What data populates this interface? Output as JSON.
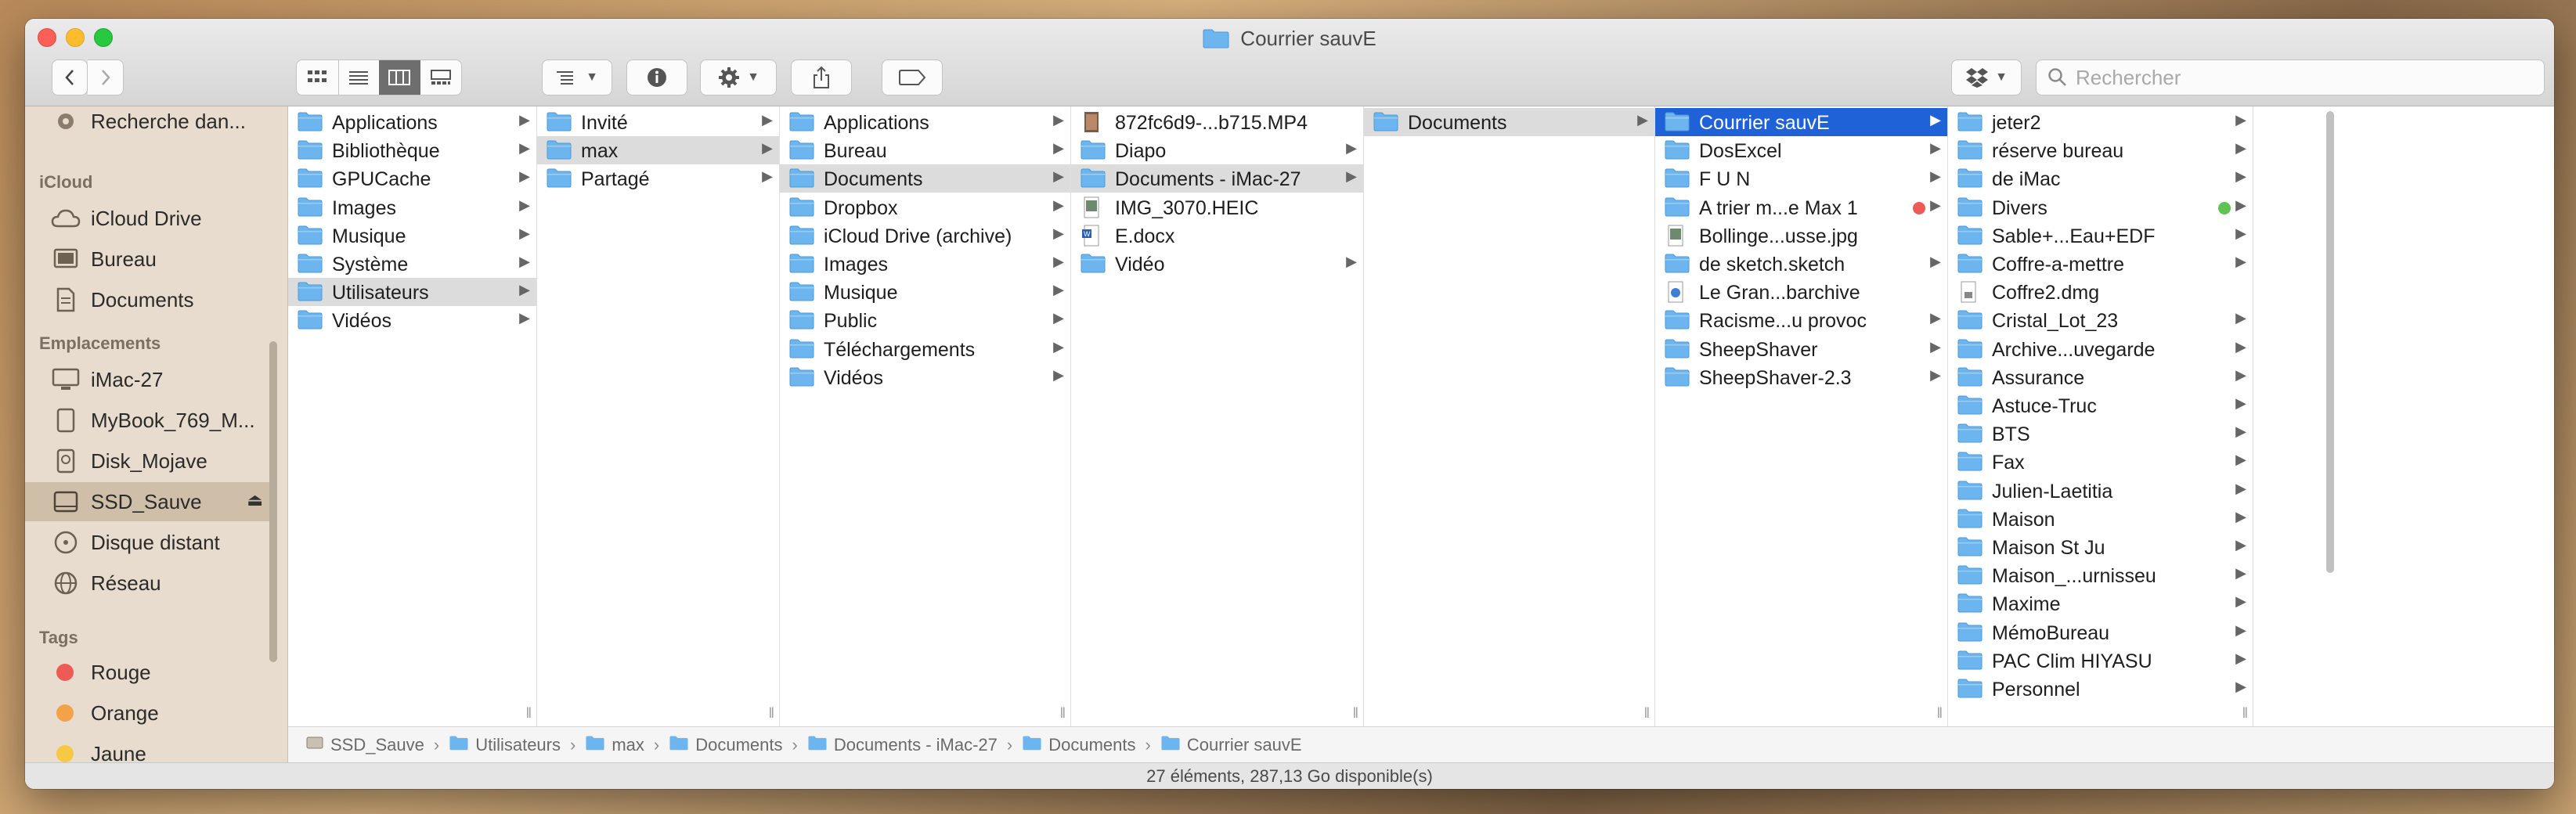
{
  "window": {
    "title": "Courrier sauvE"
  },
  "toolbar": {
    "view_modes": [
      "icon-view",
      "list-view",
      "column-view",
      "gallery-view"
    ],
    "active_view": "column-view",
    "search_placeholder": "Rechercher"
  },
  "sidebar": {
    "top_item": {
      "label": "Recherche dan...",
      "icon": "gear-icon"
    },
    "icloud_header": "iCloud",
    "icloud_items": [
      {
        "label": "iCloud Drive",
        "icon": "cloud-icon"
      },
      {
        "label": "Bureau",
        "icon": "desktop-icon"
      },
      {
        "label": "Documents",
        "icon": "document-icon"
      }
    ],
    "locations_header": "Emplacements",
    "location_items": [
      {
        "label": "iMac-27",
        "icon": "computer-icon"
      },
      {
        "label": "MyBook_769_M...",
        "icon": "disk-icon"
      },
      {
        "label": "Disk_Mojave",
        "icon": "disk-icon"
      },
      {
        "label": "SSD_Sauve",
        "icon": "disk-icon",
        "selected": true,
        "eject": "⏏"
      },
      {
        "label": "Disque distant",
        "icon": "optical-disc-icon"
      },
      {
        "label": "Réseau",
        "icon": "network-icon"
      }
    ],
    "tags_header": "Tags",
    "tags": [
      {
        "label": "Rouge",
        "color": "#ee5a55"
      },
      {
        "label": "Orange",
        "color": "#f4a24a"
      },
      {
        "label": "Jaune",
        "color": "#f6c843"
      }
    ]
  },
  "columns": [
    {
      "items": [
        {
          "label": "Applications"
        },
        {
          "label": "Bibliothèque"
        },
        {
          "label": "GPUCache"
        },
        {
          "label": "Images"
        },
        {
          "label": "Musique"
        },
        {
          "label": "Système"
        },
        {
          "label": "Utilisateurs",
          "selected": "grey"
        },
        {
          "label": "Vidéos"
        }
      ]
    },
    {
      "items": [
        {
          "label": "Invité"
        },
        {
          "label": "max",
          "selected": "grey"
        },
        {
          "label": "Partagé"
        }
      ]
    },
    {
      "items": [
        {
          "label": "Applications"
        },
        {
          "label": "Bureau"
        },
        {
          "label": "Documents",
          "selected": "grey"
        },
        {
          "label": "Dropbox"
        },
        {
          "label": "iCloud Drive (archive)"
        },
        {
          "label": "Images"
        },
        {
          "label": "Musique"
        },
        {
          "label": "Public"
        },
        {
          "label": "Téléchargements"
        },
        {
          "label": "Vidéos"
        }
      ]
    },
    {
      "items": [
        {
          "label": "872fc6d9-...b715.MP4",
          "kind": "video",
          "arrow": false
        },
        {
          "label": "Diapo"
        },
        {
          "label": "Documents - iMac-27",
          "selected": "grey"
        },
        {
          "label": "IMG_3070.HEIC",
          "kind": "image",
          "arrow": false
        },
        {
          "label": "                 E.docx",
          "kind": "word",
          "arrow": false
        },
        {
          "label": "Vidéo"
        }
      ]
    },
    {
      "items": [
        {
          "label": "Documents",
          "selected": "grey"
        }
      ]
    },
    {
      "items": [
        {
          "label": " Courrier sauvE",
          "selected": "blue"
        },
        {
          "label": " DosExcel"
        },
        {
          "label": " F U N"
        },
        {
          "label": "A trier m...e Max 1",
          "tag": "#ee5a55"
        },
        {
          "label": "Bollinge...usse.jpg",
          "kind": "image",
          "arrow": false
        },
        {
          "label": "de sketch.sketch"
        },
        {
          "label": "Le Gran...barchive",
          "kind": "archive",
          "arrow": false
        },
        {
          "label": "Racisme...u provoc"
        },
        {
          "label": "SheepShaver"
        },
        {
          "label": "SheepShaver-2.3"
        }
      ]
    },
    {
      "items": [
        {
          "label": " jeter2"
        },
        {
          "label": " réserve bureau"
        },
        {
          "label": " de iMac"
        },
        {
          "label": " Divers",
          "tag": "#5dc453"
        },
        {
          "label": " Sable+...Eau+EDF"
        },
        {
          "label": "Coffre-a-mettre"
        },
        {
          "label": "Coffre2.dmg",
          "kind": "dmg",
          "arrow": false
        },
        {
          "label": " Cristal_Lot_23"
        },
        {
          "label": "Archive...uvegarde"
        },
        {
          "label": "Assurance"
        },
        {
          "label": "Astuce-Truc"
        },
        {
          "label": "BTS"
        },
        {
          "label": "Fax"
        },
        {
          "label": "Julien-Laetitia"
        },
        {
          "label": "Maison"
        },
        {
          "label": "Maison St Ju"
        },
        {
          "label": "Maison_...urnisseu"
        },
        {
          "label": "Maxime"
        },
        {
          "label": "MémoBureau"
        },
        {
          "label": "PAC Clim HIYASU"
        },
        {
          "label": "Personnel"
        }
      ]
    }
  ],
  "pathbar": {
    "crumbs": [
      "SSD_Sauve",
      "Utilisateurs",
      "max",
      "Documents",
      "Documents - iMac-27",
      "Documents",
      "Courrier sauvE"
    ]
  },
  "status": {
    "text": "27 éléments, 287,13 Go disponible(s)"
  },
  "colors": {
    "selection_blue": "#1f62d8",
    "folder_blue": "#6cb5ef"
  }
}
